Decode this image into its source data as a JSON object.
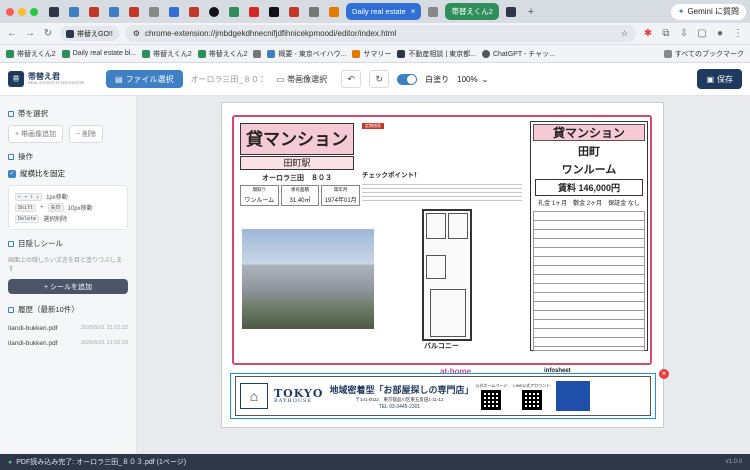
{
  "browser": {
    "active_tabs": [
      {
        "label": "帯替えGO!!",
        "color": "#2d3748"
      },
      {
        "label": "Daily real estate",
        "color": "#2f6fd6"
      },
      {
        "label": "帯替えくん2",
        "color": "#2f8f5a"
      }
    ],
    "gemini": "Gemini に質問",
    "ext_chip": "帯替えGO!!",
    "url": "chrome-extension://jmbdgekdhnecnifjdfihnicekpmoodi/editor/index.html",
    "bookmarks": [
      "帯替えくん2",
      "Daily real estate bl...",
      "帯替えくん2",
      "帯替えくん2",
      "概要 - 東京ベイハウ...",
      "サマリー",
      "不動産相談 | 東京都...",
      "ChatGPT - チャッ..."
    ],
    "all_bookmarks": "すべてのブックマーク"
  },
  "toolbar": {
    "logo_title": "帯替え君",
    "logo_sub": "REAL ESTATE FLYER EDITOR",
    "file_select": "ファイル選択",
    "filename": "オーロラ三田_８０３...",
    "band_image": "帯画像選択",
    "white_label": "白塗り",
    "zoom": "100%",
    "save": "保存"
  },
  "sidebar": {
    "band_select_title": "帯を選択",
    "add_band": "+ 帯画像追加",
    "delete_band": "− 削除",
    "ops_title": "操作",
    "keep_ratio": "縦横比を固定",
    "keys": [
      {
        "k": "← → ↑ ↓",
        "desc": "1px移動"
      },
      {
        "k": "Shift",
        "plus": "+",
        "k2": "矢印",
        "desc": "10px移動"
      },
      {
        "k": "Delete",
        "desc": "選択削除"
      }
    ],
    "seal_title": "目隠しシール",
    "seal_hint": "画面上の隠したい文言を目と塗りつぶします",
    "add_seal": "+ シールを追加",
    "history_title": "履歴（最新10件）",
    "history": [
      {
        "name": "itandi-bukken.pdf",
        "time": "2026/5/21 21:02:32"
      },
      {
        "name": "itandi-bukken.pdf",
        "time": "2026/5/21 21:02:19"
      }
    ]
  },
  "flyer": {
    "type": "貸マンション",
    "station": "田町駅",
    "building": "オーロラ三田　８０３",
    "specs": [
      {
        "label": "間取り",
        "value": "ワンルーム"
      },
      {
        "label": "専有面積",
        "value": "31.40㎡"
      },
      {
        "label": "築年月",
        "value": "1974年01月"
      }
    ],
    "red_tag": "定期借家",
    "checkpoint": "チェックポイント！",
    "balcony": "バルコニー",
    "panel_title": "貸マンション",
    "panel_town": "田町",
    "panel_layout": "ワンルーム",
    "panel_rent": "賃料 146,000円",
    "panel_fees": "礼金 1ヶ月　敷金 2ヶ月　保証金 なし",
    "athome": "at·home",
    "infosheet": "infosheet"
  },
  "banner": {
    "brand": "TOKYO",
    "brand_sub": "BAYHOUSE",
    "lead": "地域密着型「お部屋探しの専門店」",
    "address": "〒141-0022　東京都品川区東五反田1-11-12",
    "tel": "TEL 03-3445-2301",
    "homepage": "公式ホームページ",
    "line": "LINE公式アカウント"
  },
  "status": {
    "message": "PDF読み込み完了: オーロラ三田_８０３.pdf (1ページ)",
    "version": "v1.0.0"
  }
}
